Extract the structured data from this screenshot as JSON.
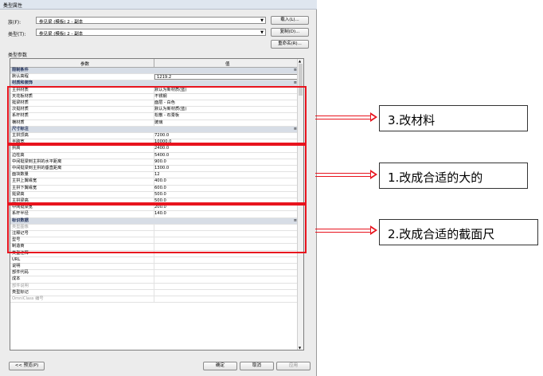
{
  "window": {
    "title": "类型属性",
    "close": "×"
  },
  "family": {
    "label": "族(F):",
    "value": "参见梁 (模板) 2 - 副本",
    "load_button": "载入(L)..."
  },
  "type": {
    "label": "类型(T):",
    "value": "参见梁 (模板) 2 - 副本",
    "duplicate_button": "复制(D)...",
    "rename_button": "重命名(R)..."
  },
  "type_params_label": "类型参数",
  "grid": {
    "col_param": "参数",
    "col_value": "值",
    "rows": [
      {
        "kind": "group",
        "param": "限制条件",
        "toggle": "≡"
      },
      {
        "kind": "edit",
        "param": "默认高程",
        "value": "1219.2"
      },
      {
        "kind": "group",
        "param": "材质和装饰",
        "toggle": "≡"
      },
      {
        "kind": "row",
        "param": "主拱材质",
        "value": "默认为新材质(蓝)"
      },
      {
        "kind": "row",
        "param": "天花板材质",
        "value": "不锈钢"
      },
      {
        "kind": "row",
        "param": "挺梁材质",
        "value": "面层 - 白色"
      },
      {
        "kind": "row",
        "param": "次挺材质",
        "value": "默认为新材质(蓝)"
      },
      {
        "kind": "row",
        "param": "系杆材质",
        "value": "松散 - 石膏板"
      },
      {
        "kind": "row",
        "param": "横材质",
        "value": "玻璃"
      },
      {
        "kind": "group",
        "param": "尺寸标注",
        "toggle": "≡"
      },
      {
        "kind": "row",
        "param": "主拱顶高",
        "value": "7200.0"
      },
      {
        "kind": "row",
        "param": "半跨宽",
        "value": "10000.0"
      },
      {
        "kind": "row",
        "param": "拱高",
        "value": "2400.0"
      },
      {
        "kind": "row",
        "param": "边柱高",
        "value": "5400.0"
      },
      {
        "kind": "row",
        "param": "中间挺梁到主拱的水平距离",
        "value": "900.0"
      },
      {
        "kind": "row",
        "param": "中间挺梁到主拱的垂直距离",
        "value": "1300.0"
      },
      {
        "kind": "row",
        "param": "面块数量",
        "value": "12"
      },
      {
        "kind": "row",
        "param": "主拱上翼缘宽",
        "value": "400.0"
      },
      {
        "kind": "row",
        "param": "主拱下翼缘宽",
        "value": "600.0"
      },
      {
        "kind": "row",
        "param": "挺梁高",
        "value": "500.0"
      },
      {
        "kind": "row",
        "param": "主拱梁高",
        "value": "500.0"
      },
      {
        "kind": "row",
        "param": "中间挺梁宽",
        "value": "200.0"
      },
      {
        "kind": "row",
        "param": "系杆半径",
        "value": "140.0"
      },
      {
        "kind": "group",
        "param": "标识数据",
        "toggle": "≡"
      },
      {
        "kind": "dis",
        "param": "类型图像",
        "value": ""
      },
      {
        "kind": "row",
        "param": "注释记号",
        "value": ""
      },
      {
        "kind": "row",
        "param": "型号",
        "value": ""
      },
      {
        "kind": "row",
        "param": "制造商",
        "value": ""
      },
      {
        "kind": "row",
        "param": "类型注释",
        "value": ""
      },
      {
        "kind": "row",
        "param": "URL",
        "value": ""
      },
      {
        "kind": "row",
        "param": "说明",
        "value": ""
      },
      {
        "kind": "row",
        "param": "部件代码",
        "value": ""
      },
      {
        "kind": "row",
        "param": "成本",
        "value": ""
      },
      {
        "kind": "dis",
        "param": "部件说明",
        "value": ""
      },
      {
        "kind": "row",
        "param": "类型标记",
        "value": ""
      },
      {
        "kind": "dis",
        "param": "OmniClass 编号",
        "value": ""
      }
    ]
  },
  "footer": {
    "preview_button": "<< 预览(P)",
    "ok_button": "确定",
    "cancel_button": "取消",
    "apply_button": "应用"
  },
  "annotations": [
    {
      "text": "3.改材料"
    },
    {
      "text": "1.改成合适的大的"
    },
    {
      "text": "2.改成合适的截面尺"
    }
  ],
  "colors": {
    "highlight": "#e8141e",
    "group_row": "#d7dde6",
    "group_text": "#1c2c56"
  }
}
